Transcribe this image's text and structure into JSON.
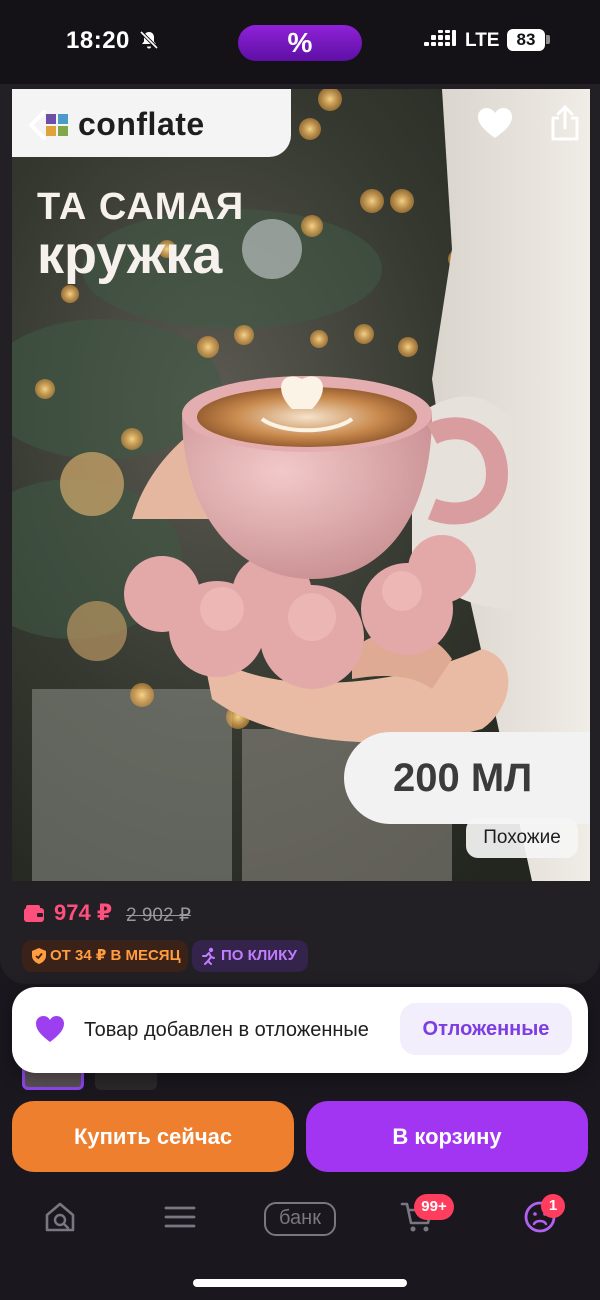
{
  "status_bar": {
    "time": "18:20",
    "promo_symbol": "%",
    "network": "LTE",
    "battery": "83"
  },
  "product": {
    "brand": "conflate",
    "headline_line1": "ТА САМАЯ",
    "headline_line2": "кружка",
    "volume": "200 МЛ",
    "similar_label": "Похожие",
    "price_current": "974 ₽",
    "price_old": "2 902 ₽",
    "installment": "ОТ 34 ₽ В МЕСЯЦ",
    "click_badge": "ПО КЛИКУ"
  },
  "toast": {
    "message": "Товар добавлен в отложенные",
    "action": "Отложенные"
  },
  "actions": {
    "buy_now": "Купить сейчас",
    "add_to_cart": "В корзину"
  },
  "bottom_nav": {
    "bank_label": "банк",
    "cart_badge": "99+",
    "profile_badge": "1"
  },
  "colors": {
    "accent_purple": "#a135f2",
    "buy_orange": "#ee7f2e",
    "price_pink": "#ff4f7d",
    "background": "#1a171e"
  },
  "icons": [
    "bell-slash-icon",
    "signal-icon",
    "back-icon",
    "heart-icon",
    "share-icon",
    "wallet-icon",
    "shield-icon",
    "run-icon",
    "home-search-icon",
    "menu-icon",
    "cart-icon",
    "profile-icon"
  ]
}
